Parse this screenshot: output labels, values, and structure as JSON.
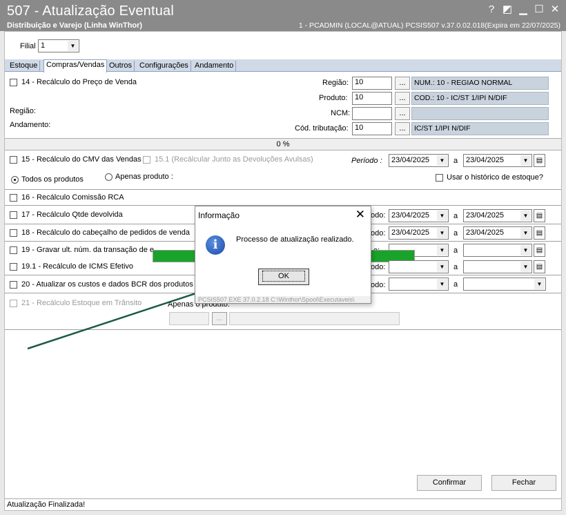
{
  "window": {
    "title": "507 - Atualização Eventual",
    "subtitle": "Distribuição e Varejo (Linha WinThor)",
    "status": "1 - PCADMIN (LOCAL@ATUAL)   PCSIS507  v.37.0.02.018(Expira em 22/07/2025)",
    "help": "?",
    "minimize": "▁",
    "maximize": "☐",
    "close": "✕",
    "restore": "◩"
  },
  "filial": {
    "label": "Filial",
    "value": "1"
  },
  "tabs": [
    "Estoque",
    "Compras/Vendas",
    "Outros",
    "Configurações",
    "Andamento"
  ],
  "s14": {
    "label": "14 - Recálculo do Preço de Venda",
    "regiao_label": "Região:",
    "andamento_label": "Andamento:",
    "regiao_field": {
      "label": "Região:",
      "value": "10",
      "desc": "NUM.: 10 - REGIAO NORMAL"
    },
    "produto_field": {
      "label": "Produto:",
      "value": "10",
      "desc": "COD.: 10 - IC/ST 1/IPI N/DIF"
    },
    "ncm_field": {
      "label": "NCM:",
      "value": "",
      "desc": ""
    },
    "cod_field": {
      "label": "Cód. tributação:",
      "value": "10",
      "desc": "IC/ST 1/IPI N/DIF"
    },
    "progress": "0 %"
  },
  "dots": "...",
  "s15": {
    "label": "15 - Recálculo do CMV das Vendas",
    "sub": "15.1 (Recálcular Junto as Devoluções Avulsas)",
    "periodo": "Período :",
    "from": "23/04/2025",
    "a": "a",
    "to": "23/04/2025",
    "todos": "Todos os produtos",
    "apenas": "Apenas produto :",
    "historico": "Usar o histórico de estoque?"
  },
  "s16": {
    "label": "16 - Recálculo Comissão RCA"
  },
  "s17": {
    "label": "17 - Recálculo Qtde devolvida",
    "periodo": "odo:",
    "from": "23/04/2025",
    "a": "a",
    "to": "23/04/2025"
  },
  "s18": {
    "label": "18 - Recálculo do cabeçalho de pedidos de venda",
    "periodo": "odo:",
    "from": "23/04/2025",
    "a": "a",
    "to": "23/04/2025"
  },
  "s19": {
    "label": "19 - Gravar ult. núm. da transação de e",
    "periodo": "o:",
    "a": "a"
  },
  "s191": {
    "label": "19.1 - Recálculo de ICMS Efetivo",
    "periodo": "odo:",
    "a": "a"
  },
  "s20": {
    "label": "20 - Atualizar os custos e dados BCR dos produtos fi",
    "periodo": "odo:",
    "a": "a"
  },
  "s21": {
    "label": "21 - Recálculo Estoque em Trânsito",
    "apenas": "Apenas o produto:"
  },
  "buttons": {
    "confirmar": "Confirmar",
    "fechar": "Fechar"
  },
  "statusbar": "Atualização Finalizada!",
  "dialog": {
    "title": "Informação",
    "close": "✕",
    "icon": "i",
    "message": "Processo de atualização realizado.",
    "ok": "OK",
    "footer": "PCSIS507.EXE 37.0.2.18 C:\\Winthor\\Spool\\Executaveis\\"
  },
  "colors": {
    "titlebar": "#8a8a8a",
    "progress_green": "#1aa32a",
    "arrow": "#1c5a4a",
    "tabstrip": "#d0d9e6"
  }
}
